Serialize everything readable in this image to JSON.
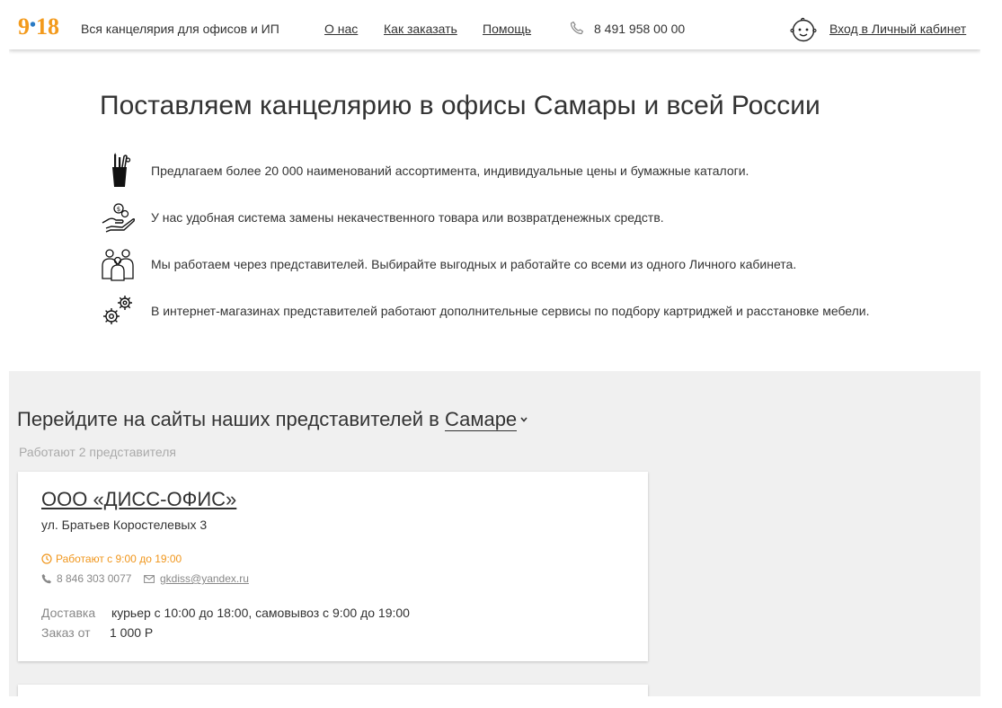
{
  "header": {
    "logo": {
      "left": "9",
      "dot": "•",
      "right": "18"
    },
    "tagline": "Вся канцелярия для офисов и ИП",
    "nav": [
      {
        "label": "О нас"
      },
      {
        "label": "Как заказать"
      },
      {
        "label": "Помощь"
      }
    ],
    "phone": "8 491 958 00 00",
    "login": "Вход в Личный кабинет"
  },
  "hero": {
    "title": "Поставляем канцелярию в офисы Самары и всей России",
    "features": [
      {
        "icon": "pencil-cup-icon",
        "text": "Предлагаем более 20 000 наименований ассортимента, индивидуальные цены и бумажные каталоги."
      },
      {
        "icon": "hand-coins-icon",
        "text": "У нас удобная система замены некачественного товара или возвратденежных средств."
      },
      {
        "icon": "people-icon",
        "text": "Мы работаем через представителей. Выбирайте выгодных и работайте со всеми из одного Личного кабинета."
      },
      {
        "icon": "gears-icon",
        "text": "В интернет-магазинах представителей работают дополнительные сервисы по подбору картриджей и расстановке мебели."
      }
    ]
  },
  "representatives": {
    "title_prefix": "Перейдите на сайты наших представителей в",
    "city": "Самаре",
    "subtitle": "Работают 2 представителя",
    "cards": [
      {
        "name": "ООО «ДИСС-ОФИС»",
        "address": "ул. Братьев Коростелевых 3",
        "hours": "Работают с 9:00 до 19:00",
        "phone": "8 846 303 0077",
        "email": "gkdiss@yandex.ru",
        "delivery_label": "Доставка",
        "delivery_value": "курьер с 10:00 до 18:00, самовывоз с 9:00 до 19:00",
        "min_order_label": "Заказ от",
        "min_order_value": "1 000 Р"
      }
    ]
  },
  "colors": {
    "accent": "#f39a1c",
    "logo_dot": "#2b7bc4",
    "section_bg": "#f0f0f0"
  }
}
